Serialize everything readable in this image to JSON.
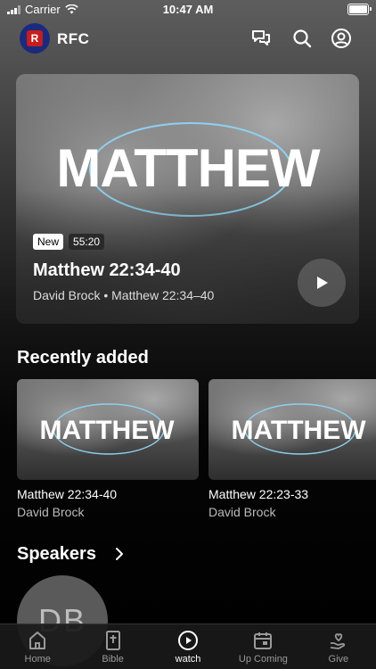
{
  "status_bar": {
    "carrier": "Carrier",
    "time": "10:47 AM"
  },
  "header": {
    "brand": "RFC",
    "logo_letter": "R"
  },
  "hero": {
    "art_text": "MATTHEW",
    "badge_new": "New",
    "duration": "55:20",
    "title": "Matthew 22:34-40",
    "subtitle": "David Brock • Matthew 22:34–40"
  },
  "recent": {
    "title": "Recently added",
    "items": [
      {
        "art_text": "MATTHEW",
        "title": "Matthew 22:34-40",
        "speaker": "David Brock"
      },
      {
        "art_text": "MATTHEW",
        "title": "Matthew 22:23-33",
        "speaker": "David Brock"
      }
    ]
  },
  "speakers": {
    "title": "Speakers",
    "items": [
      {
        "initials": "DB"
      }
    ]
  },
  "tabs": [
    {
      "label": "Home",
      "icon": "home-icon"
    },
    {
      "label": "Bible",
      "icon": "bible-icon"
    },
    {
      "label": "watch",
      "icon": "play-circle-icon"
    },
    {
      "label": "Up Coming",
      "icon": "calendar-icon"
    },
    {
      "label": "Give",
      "icon": "heart-hand-icon"
    }
  ],
  "active_tab": "watch",
  "colors": {
    "accent_logo_bg": "#1c2a7d",
    "logo_red": "#c51e1e",
    "ellipse_stroke": "#8fd0f0"
  }
}
